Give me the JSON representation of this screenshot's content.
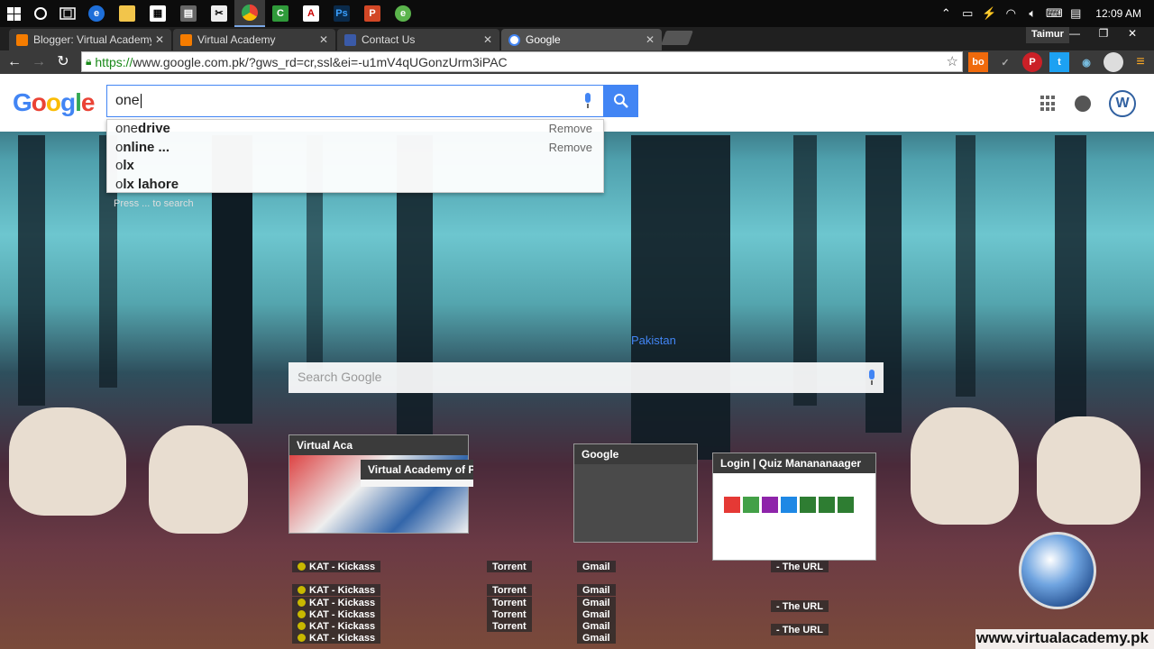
{
  "taskbar": {
    "apps": [
      "start-icon",
      "cortana-icon",
      "task-view-icon",
      "edge-icon",
      "file-explorer-icon",
      "store-icon",
      "calculator-icon",
      "snipping-tool-icon",
      "chrome-icon",
      "camtasia-icon",
      "acrobat-icon",
      "photoshop-icon",
      "powerpoint-icon",
      "evernote-icon"
    ],
    "clock": "12:09 AM"
  },
  "tabs": [
    {
      "label": "Blogger: Virtual Academy",
      "favicon_color": "#f57c00"
    },
    {
      "label": "Virtual Academy",
      "favicon_color": "#f57c00"
    },
    {
      "label": "Contact Us",
      "favicon_color": "#3a5aa8"
    },
    {
      "label": "Google",
      "favicon_color": "#4285f4",
      "active": true
    }
  ],
  "profile_name": "Taimur",
  "address_bar": {
    "scheme": "https://",
    "url_rest": "www.google.com.pk/?gws_rd=cr,ssl&ei=-u1mV4qUGonzUrm3iPAC"
  },
  "google": {
    "logo": "Google",
    "query": "one",
    "suggestions": [
      {
        "prefix": "one",
        "rest": "drive",
        "remove": "Remove"
      },
      {
        "prefix": "o",
        "rest": "nline ...",
        "remove": "Remove"
      },
      {
        "prefix": "o",
        "rest": "lx",
        "remove": ""
      },
      {
        "prefix": "o",
        "rest": "lx lahore",
        "remove": ""
      }
    ],
    "hint": "Press ... to search",
    "page_search_placeholder": "Search Google",
    "country": "Pakistan",
    "avatar_letter": "W"
  },
  "tiles": [
    {
      "title": "Virtual Aca"
    },
    {
      "title": "Virtual Academy of P"
    },
    {
      "title": "Google"
    },
    {
      "title": "Login | Quiz Manananaager"
    }
  ],
  "list_rows": {
    "kat": "KAT - Kickass",
    "torrent": "Torrent",
    "gmail": "Gmail",
    "url": "- The URL"
  },
  "watermark": "www.virtualacademy.pk",
  "colors": {
    "google_blue": "#4285f4",
    "google_red": "#ea4335",
    "google_yellow": "#fbbc05",
    "google_green": "#34a853"
  }
}
